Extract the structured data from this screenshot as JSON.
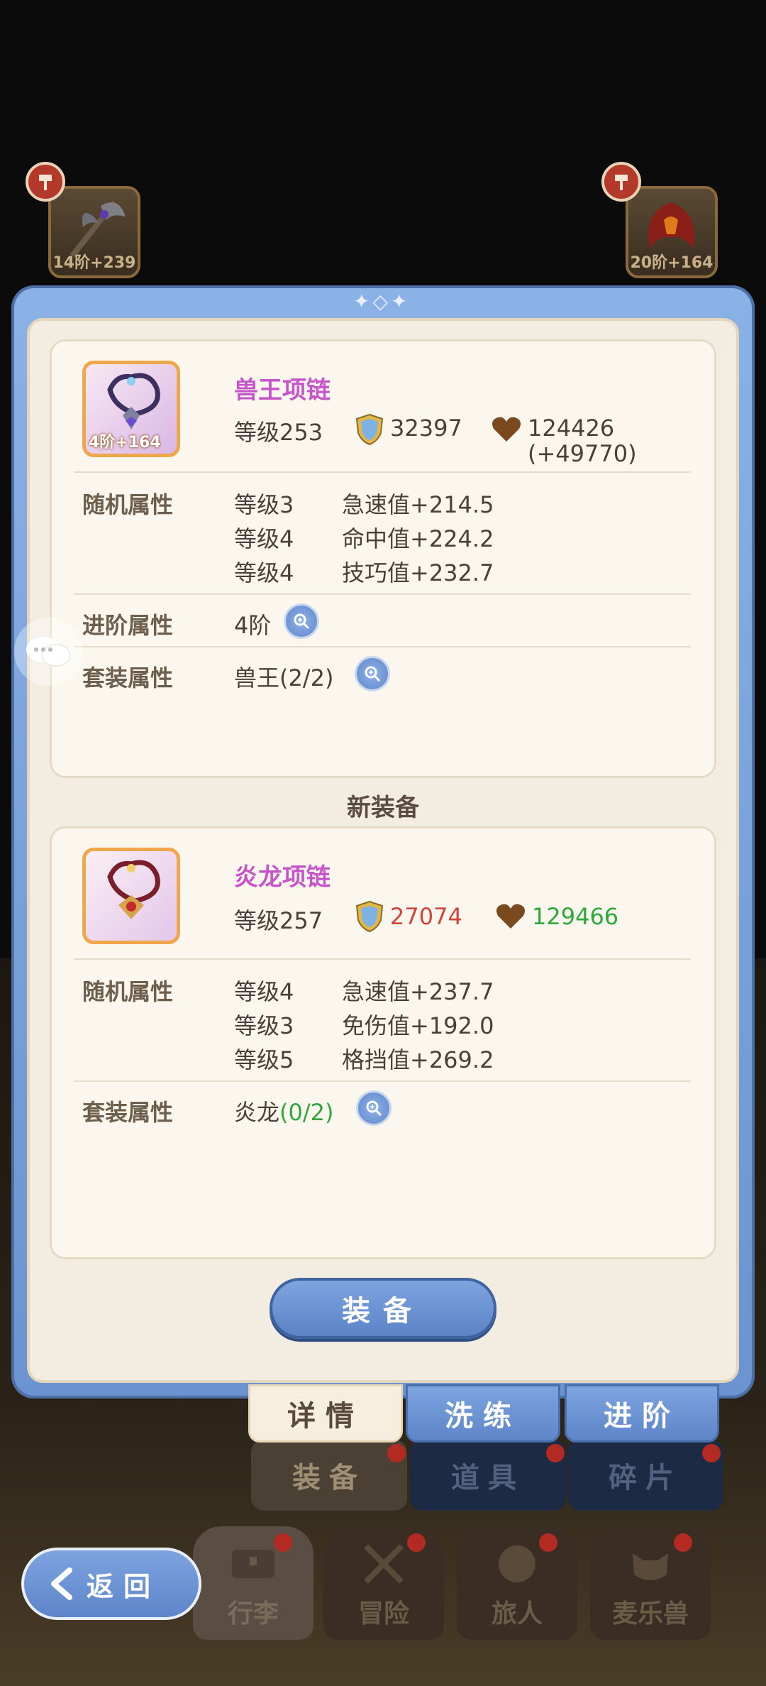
{
  "top_slots": [
    {
      "level_label": "14阶+239",
      "slot": "weapon"
    },
    {
      "level_label": "20阶+164",
      "slot": "armor"
    }
  ],
  "current_item": {
    "name": "兽王项链",
    "icon_tag": "4阶+164",
    "level": "等级253",
    "defense": "32397",
    "hp": "124426",
    "hp_bonus": "(+49770)",
    "random_label": "随机属性",
    "random_attrs": [
      {
        "level": "等级3",
        "stat": "急速值+214.5"
      },
      {
        "level": "等级4",
        "stat": "命中值+224.2"
      },
      {
        "level": "等级4",
        "stat": "技巧值+232.7"
      }
    ],
    "advance_label": "进阶属性",
    "advance_value": "4阶",
    "set_label": "套装属性",
    "set_value": "兽王(2/2)"
  },
  "new_header": "新装备",
  "new_item": {
    "name": "炎龙项链",
    "level": "等级257",
    "defense": "27074",
    "hp": "129466",
    "random_label": "随机属性",
    "random_attrs": [
      {
        "level": "等级4",
        "stat": "急速值+237.7"
      },
      {
        "level": "等级3",
        "stat": "免伤值+192.0"
      },
      {
        "level": "等级5",
        "stat": "格挡值+269.2"
      }
    ],
    "set_label": "套装属性",
    "set_name": "炎龙",
    "set_count": "(0/2)"
  },
  "equip_button": "装备",
  "tabs": [
    "详情",
    "洗练",
    "进阶"
  ],
  "sub_tabs": [
    "装备",
    "道具",
    "碎片"
  ],
  "bottom_nav": [
    "行李",
    "冒险",
    "旅人",
    "麦乐兽"
  ],
  "back_button": "返回",
  "colors": {
    "panel_blue": "#7ea4df",
    "item_name": "#c655c9",
    "lower_value": "#d2443a",
    "higher_value": "#2da83a"
  }
}
